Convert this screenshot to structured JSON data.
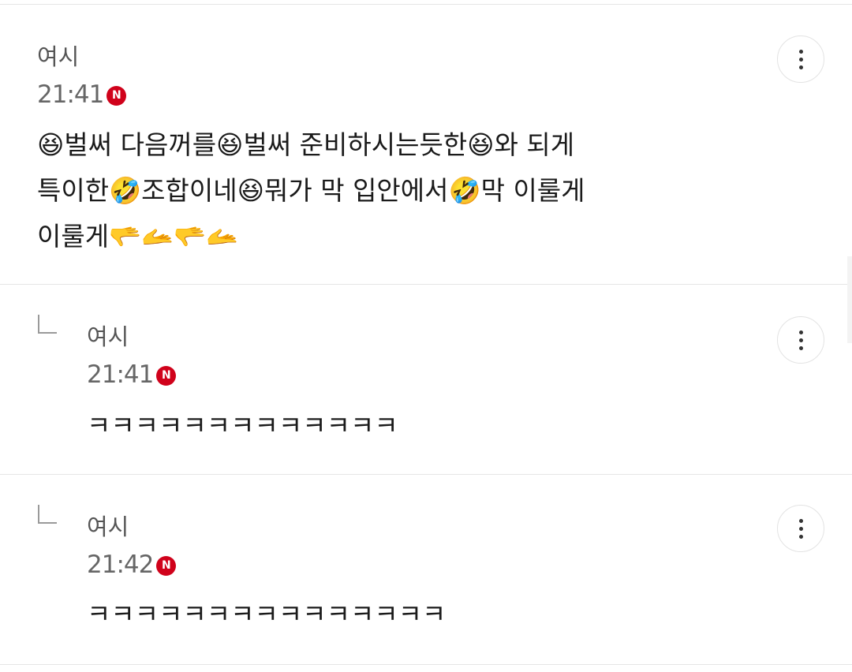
{
  "comments": [
    {
      "author": "여시",
      "time": "21:41",
      "badge": "N",
      "lines": [
        "😆벌써 다음꺼를😆벌써 준비하시는듯한😆와 되게",
        "특이한🤣조합이네😆뭐가 막 입안에서🤣막 이룰게",
        "이룰게🫳🫴🫳🫴"
      ]
    },
    {
      "author": "여시",
      "time": "21:41",
      "badge": "N",
      "text": "ㅋㅋㅋㅋㅋㅋㅋㅋㅋㅋㅋㅋㅋ"
    },
    {
      "author": "여시",
      "time": "21:42",
      "badge": "N",
      "text": "ㅋㅋㅋㅋㅋㅋㅋㅋㅋㅋㅋㅋㅋㅋㅋ"
    }
  ],
  "icons": {
    "more": "more-vertical-icon",
    "reply": "reply-arrow-icon"
  },
  "colors": {
    "badge": "#d0021b",
    "divider": "#e6e6e6"
  }
}
